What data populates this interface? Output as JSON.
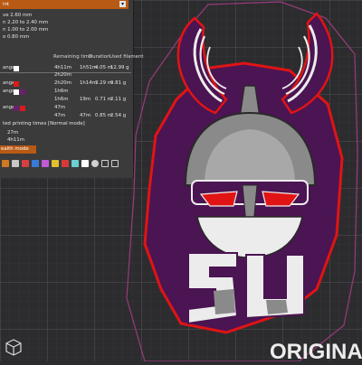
{
  "panel": {
    "title": "int",
    "range_lines": [
      "ve 2.60 mm",
      "n 2.20 to 2.40 mm",
      "n 1.00 to 2.00 mm",
      "o 0.80 mm"
    ],
    "table_headers": [
      "Remaining time",
      "Duration",
      "Used filament"
    ],
    "rows": [
      {
        "label": "ange",
        "remaining": "4h11m",
        "duration": "1h51m",
        "meters": "4.05 m",
        "grams": "12.99 g",
        "color": "#ffffff"
      },
      {
        "label": "",
        "remaining": "2h20m",
        "duration": "",
        "meters": "",
        "grams": "",
        "color": ""
      },
      {
        "label": "ange",
        "remaining": "2h20m",
        "duration": "1h14m",
        "meters": "3.29 m",
        "grams": "9.81 g",
        "color": "#d81b1b"
      },
      {
        "label": "ange",
        "remaining": "1h6m",
        "duration": "",
        "meters": "",
        "grams": "",
        "color": "#6b1f6f"
      },
      {
        "label": "",
        "remaining": "1h6m",
        "duration": "19m",
        "meters": "0.71 m",
        "grams": "2.11 g",
        "color": ""
      },
      {
        "label": "ange",
        "remaining": "47m",
        "duration": "",
        "meters": "",
        "grams": "",
        "color": "#d81b1b"
      },
      {
        "label": "",
        "remaining": "47m",
        "duration": "47m",
        "meters": "0.85 m",
        "grams": "2.54 g",
        "color": ""
      }
    ],
    "estimated_label": "ted printing times [Normal mode]",
    "time_lines": [
      "27m",
      "4h11m"
    ],
    "mode_button": "ealth mode"
  },
  "viewport": {
    "banner_text": "ORIGINAL",
    "colors": {
      "bg": "#2c2c2f",
      "grid": "#4a4a4e",
      "purple": "#4b1452",
      "red": "#e01414",
      "gray": "#8a8a8a",
      "white": "#ececec",
      "accent": "#b85a14"
    }
  }
}
